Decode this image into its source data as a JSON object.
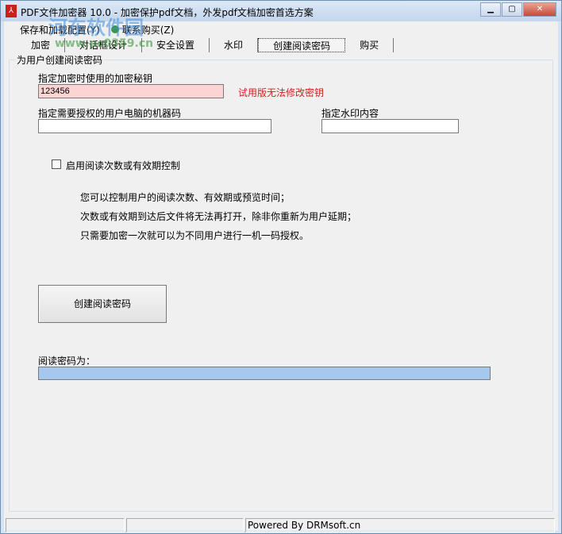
{
  "window": {
    "title": "PDF文件加密器 10.0 - 加密保护pdf文档，外发pdf文档加密首选方案",
    "min": "▁",
    "max": "▢",
    "close": "✕"
  },
  "menu": [
    {
      "label": "保存和加载配置(Y)"
    },
    {
      "label": "联系购买(Z)"
    }
  ],
  "tabs": [
    "加密",
    "对话框设计",
    "安全设置",
    "水印",
    "创建阅读密码",
    "购买"
  ],
  "group_title": "为用户创建阅读密码",
  "key": {
    "label": "指定加密时使用的加密秘钥",
    "value": "123456",
    "warning": "试用版无法修改密钥"
  },
  "machine": {
    "label": "指定需要授权的用户电脑的机器码",
    "value": ""
  },
  "watermark_field": {
    "label": "指定水印内容",
    "value": ""
  },
  "checkbox_label": "启用阅读次数或有效期控制",
  "info": [
    "您可以控制用户的阅读次数、有效期或预览时间；",
    "次数或有效期到达后文件将无法再打开，除非你重新为用户延期；",
    "只需要加密一次就可以为不同用户进行一机一码授权。"
  ],
  "create_button": "创建阅读密码",
  "result_label": "阅读密码为：",
  "status": [
    "",
    "",
    "Powered By DRMsoft.cn"
  ],
  "overlay": {
    "site_name": "河东软件园",
    "site_url": "www.pc0359.cn"
  }
}
